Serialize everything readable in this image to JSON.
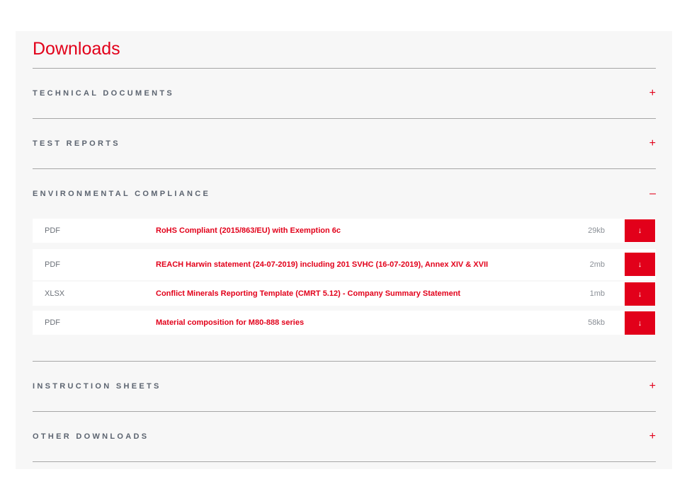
{
  "page": {
    "title": "Downloads"
  },
  "sections": [
    {
      "label": "TECHNICAL DOCUMENTS",
      "toggle": "+"
    },
    {
      "label": "TEST REPORTS",
      "toggle": "+"
    },
    {
      "label": "ENVIRONMENTAL COMPLIANCE",
      "toggle": "–"
    },
    {
      "label": "INSTRUCTION SHEETS",
      "toggle": "+"
    },
    {
      "label": "OTHER DOWNLOADS",
      "toggle": "+"
    }
  ],
  "files": [
    {
      "type": "PDF",
      "name": "RoHS Compliant (2015/863/EU) with Exemption 6c",
      "size": "29kb",
      "icon": "↓"
    },
    {
      "type": "PDF",
      "name": "REACH Harwin statement (24-07-2019) including 201 SVHC (16-07-2019), Annex XIV & XVII",
      "size": "2mb",
      "icon": "↓"
    },
    {
      "type": "XLSX",
      "name": "Conflict Minerals Reporting Template (CMRT 5.12) - Company Summary Statement",
      "size": "1mb",
      "icon": "↓"
    },
    {
      "type": "PDF",
      "name": "Material composition for M80-888 series",
      "size": "58kb",
      "icon": "↓"
    }
  ],
  "colors": {
    "accent": "#e2001a",
    "panel_bg": "#f7f7f7",
    "divider": "#a6a6a6",
    "label": "#5c6470"
  }
}
